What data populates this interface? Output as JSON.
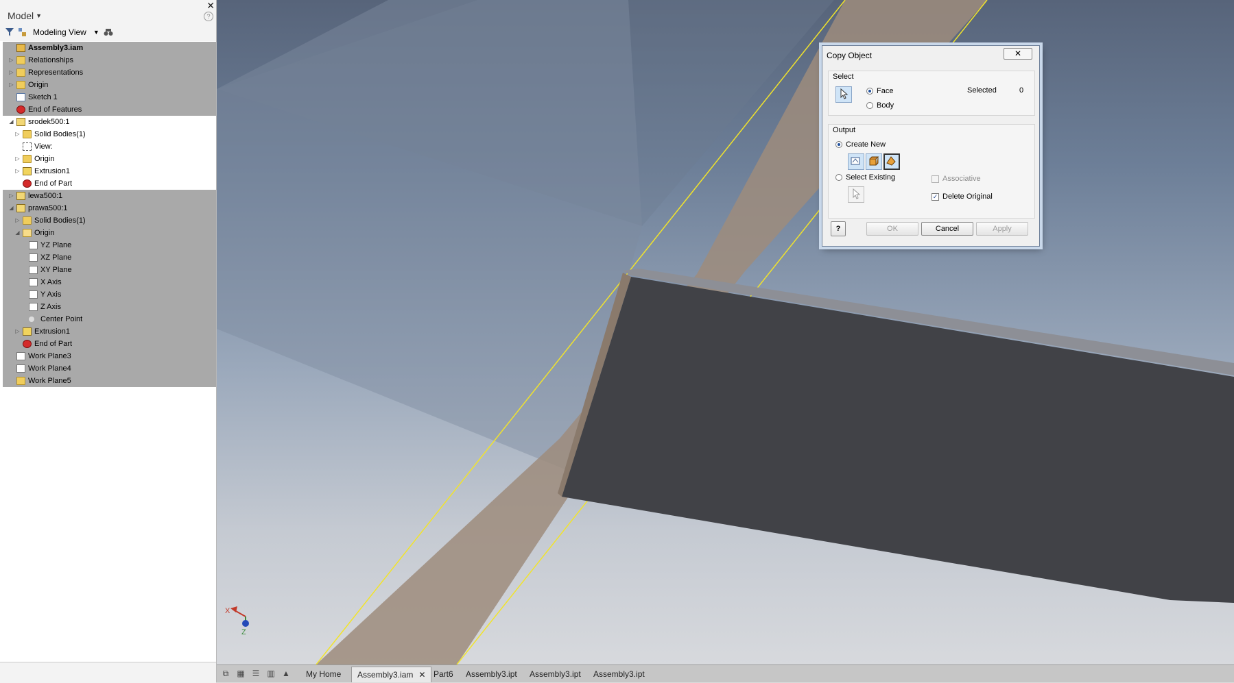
{
  "browser": {
    "title": "Model",
    "toolbar": {
      "view_label": "Modeling View"
    },
    "tree": [
      {
        "label": "Assembly3.iam",
        "icon": "assembly-icon",
        "bold": true,
        "selected": true,
        "expander": "",
        "level": 0
      },
      {
        "label": "Relationships",
        "icon": "folder-icon",
        "selected": true,
        "expander": "▷",
        "level": 0
      },
      {
        "label": "Representations",
        "icon": "representations-icon",
        "selected": true,
        "expander": "▷",
        "level": 0
      },
      {
        "label": "Origin",
        "icon": "folder-icon",
        "selected": true,
        "expander": "▷",
        "level": 0
      },
      {
        "label": "Sketch 1",
        "icon": "sketch-icon",
        "selected": true,
        "expander": "",
        "level": 0
      },
      {
        "label": "End of Features",
        "icon": "end-icon",
        "selected": true,
        "expander": "",
        "level": 0
      },
      {
        "label": "srodek500:1",
        "icon": "part-icon",
        "selected": false,
        "expander": "◢",
        "level": 0
      },
      {
        "label": "Solid Bodies(1)",
        "icon": "solid-bodies-icon",
        "selected": false,
        "expander": "▷",
        "level": 1
      },
      {
        "label": "View:",
        "icon": "view-icon",
        "selected": false,
        "expander": "",
        "level": 1
      },
      {
        "label": "Origin",
        "icon": "folder-icon",
        "selected": false,
        "expander": "▷",
        "level": 1
      },
      {
        "label": "Extrusion1",
        "icon": "extrusion-icon",
        "selected": false,
        "expander": "▷",
        "level": 1
      },
      {
        "label": "End of Part",
        "icon": "end-icon",
        "selected": false,
        "expander": "",
        "level": 1
      },
      {
        "label": "lewa500:1",
        "icon": "part-icon",
        "selected": true,
        "expander": "▷",
        "level": 0
      },
      {
        "label": "prawa500:1",
        "icon": "part-icon",
        "selected": true,
        "expander": "◢",
        "level": 0
      },
      {
        "label": "Solid Bodies(1)",
        "icon": "solid-bodies-icon",
        "selected": true,
        "expander": "▷",
        "level": 1
      },
      {
        "label": "Origin",
        "icon": "folder-open-icon",
        "selected": true,
        "expander": "◢",
        "level": 1
      },
      {
        "label": "YZ Plane",
        "icon": "plane-icon",
        "selected": true,
        "expander": "",
        "level": 2
      },
      {
        "label": "XZ Plane",
        "icon": "plane-icon",
        "selected": true,
        "expander": "",
        "level": 2
      },
      {
        "label": "XY Plane",
        "icon": "plane-icon",
        "selected": true,
        "expander": "",
        "level": 2
      },
      {
        "label": "X Axis",
        "icon": "axis-icon",
        "selected": true,
        "expander": "",
        "level": 2
      },
      {
        "label": "Y Axis",
        "icon": "axis-icon",
        "selected": true,
        "expander": "",
        "level": 2
      },
      {
        "label": "Z Axis",
        "icon": "axis-icon",
        "selected": true,
        "expander": "",
        "level": 2
      },
      {
        "label": "Center Point",
        "icon": "point-icon",
        "selected": true,
        "expander": "",
        "level": 2
      },
      {
        "label": "Extrusion1",
        "icon": "extrusion-icon",
        "selected": true,
        "expander": "▷",
        "level": 1
      },
      {
        "label": "End of Part",
        "icon": "end-icon",
        "selected": true,
        "expander": "",
        "level": 1
      },
      {
        "label": "Work Plane3",
        "icon": "plane-icon",
        "selected": true,
        "expander": "",
        "level": 0
      },
      {
        "label": "Work Plane4",
        "icon": "plane-icon",
        "selected": true,
        "expander": "",
        "level": 0
      },
      {
        "label": "Work Plane5",
        "icon": "workplane-orange-icon",
        "selected": true,
        "expander": "",
        "level": 0
      }
    ]
  },
  "triad": {
    "x_label": "X",
    "z_label": "Z"
  },
  "dialog": {
    "title": "Copy Object",
    "select_group": "Select",
    "face_label": "Face",
    "body_label": "Body",
    "selected_label": "Selected",
    "selected_count": "0",
    "output_group": "Output",
    "create_new_label": "Create New",
    "select_existing_label": "Select Existing",
    "associative_label": "Associative",
    "delete_original_label": "Delete Original",
    "ok_label": "OK",
    "cancel_label": "Cancel",
    "apply_label": "Apply",
    "face_checked": true,
    "create_new_checked": true,
    "associative_checked": false,
    "delete_original_checked": true
  },
  "tabs": {
    "items": [
      "My Home",
      "Assembly3.iam",
      "Part6",
      "Assembly3.ipt",
      "Assembly3.ipt",
      "Assembly3.ipt"
    ],
    "active_index": 1
  },
  "colors": {
    "viewport_top": "#57647a",
    "viewport_bottom": "#d7d9dd",
    "beam": "#9e8c7c",
    "block": "#414247",
    "highlight": "#f2e42a",
    "selected_row": "#a9a9a9"
  }
}
